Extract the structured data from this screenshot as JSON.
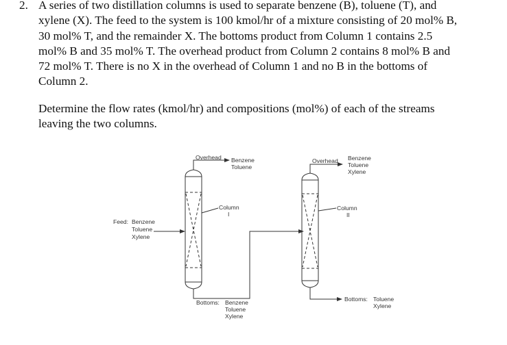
{
  "problem": {
    "number": "2.",
    "statement_lines": [
      "A series of two distillation columns is used to separate benzene (B), toluene (T), and",
      "xylene (X).  The feed to the system is 100 kmol/hr of a mixture consisting of 20 mol% B,",
      "30 mol% T, and the remainder X.  The bottoms product from Column 1 contains 2.5",
      "mol% B and 35 mol% T.  The overhead product from Column 2 contains 8 mol% B and",
      "72 mol% T.  There is no X in the overhead of Column 1 and no B in the bottoms of",
      "Column 2."
    ],
    "question_lines": [
      "Determine the flow rates (kmol/hr) and compositions (mol%) of each of the streams",
      "leaving the two columns."
    ]
  },
  "diagram": {
    "line_color": "#333333",
    "feed": {
      "label": "Feed:",
      "components": [
        "Benzene",
        "Toluene",
        "Xylene"
      ]
    },
    "column1": {
      "label": "Column",
      "numeral": "I",
      "overhead_label": "Overhead",
      "overhead_components": [
        "Benzene",
        "Toluene"
      ],
      "bottoms_label": "Bottoms:",
      "bottoms_components": [
        "Benzene",
        "Toluene",
        "Xylene"
      ]
    },
    "column2": {
      "label": "Column",
      "numeral": "II",
      "overhead_label": "Overhead",
      "overhead_components": [
        "Benzene",
        "Toluene",
        "Xylene"
      ],
      "bottoms_label": "Bottoms:",
      "bottoms_components": [
        "Toluene",
        "Xylene"
      ]
    }
  }
}
